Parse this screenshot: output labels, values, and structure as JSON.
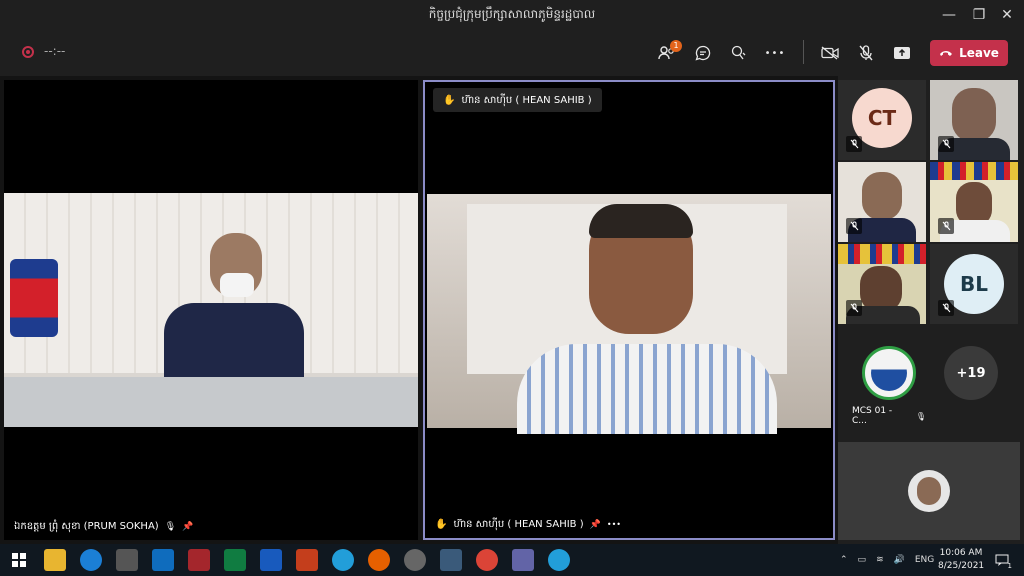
{
  "window": {
    "title": "កិច្ចប្រជុំក្រុមប្រឹក្សាសាលាភូមិន្ទរដ្ឋបាល",
    "minimize": "—",
    "maximize": "❐",
    "close": "✕"
  },
  "toolbar": {
    "timer": "--:--",
    "participants_badge": "1",
    "more": "•••",
    "leave_label": "Leave"
  },
  "stage": {
    "left_name": "ឯកឧត្តម ព្រុំ សុខា (PRUM SOKHA)",
    "right_chip": "ហ៊ាន សាហ៊ីប ( HEAN SAHIB )",
    "right_name": "ហ៊ាន សាហ៊ីប ( HEAN SAHIB )",
    "right_more": "•••"
  },
  "sidebar": {
    "ct_initials": "CT",
    "bl_initials": "BL",
    "overflow_count": "+19",
    "mcs_label": "MCS 01 - C..."
  },
  "taskbar": {
    "lang": "ENG",
    "time": "10:06 AM",
    "date": "8/25/2021",
    "notif_count": "1"
  },
  "colors": {
    "accent": "#6264a7",
    "leave": "#c4314b",
    "badge": "#e3641b"
  }
}
